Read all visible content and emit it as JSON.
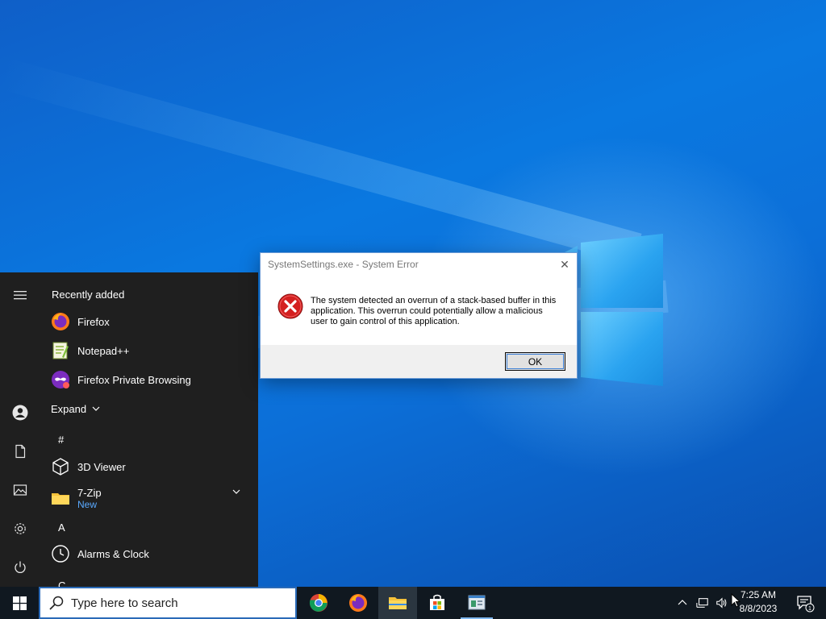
{
  "start_menu": {
    "recently_added_heading": "Recently added",
    "recent_apps": [
      {
        "label": "Firefox",
        "icon": "firefox-icon"
      },
      {
        "label": "Notepad++",
        "icon": "notepadpp-icon"
      },
      {
        "label": "Firefox Private Browsing",
        "icon": "firefox-private-icon"
      }
    ],
    "expand_label": "Expand",
    "letter_hash": "#",
    "app_3dviewer": "3D Viewer",
    "app_7zip": "7-Zip",
    "app_7zip_sub": "New",
    "letter_a": "A",
    "app_alarms": "Alarms & Clock",
    "letter_c": "C",
    "rail": [
      "hamburger-icon",
      "user-icon",
      "documents-icon",
      "pictures-icon",
      "settings-icon",
      "power-icon"
    ]
  },
  "dialog": {
    "title": "SystemSettings.exe - System Error",
    "message": "The system detected an overrun of a stack-based buffer in this application. This overrun could potentially allow a malicious user to gain control of this application.",
    "ok_label": "OK",
    "close_glyph": "✕"
  },
  "taskbar": {
    "search_placeholder": "Type here to search",
    "pinned": [
      "chrome-icon",
      "firefox-icon",
      "file-explorer-icon",
      "microsoft-store-icon",
      "control-panel-icon"
    ],
    "time": "7:25 AM",
    "date": "8/8/2023",
    "notification_count": "1"
  },
  "colors": {
    "accent": "#2a6ab8",
    "start_bg": "#1f1f1f",
    "taskbar_bg": "#101820",
    "error_red": "#d42020"
  }
}
